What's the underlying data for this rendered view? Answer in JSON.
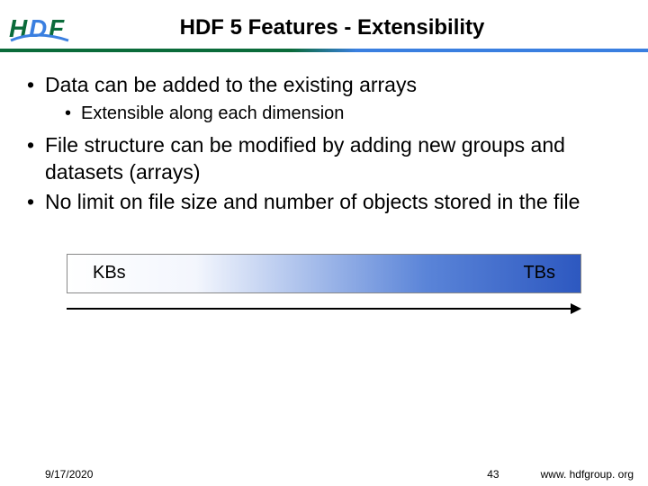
{
  "header": {
    "title": "HDF 5 Features - Extensibility",
    "logo_text": "HDF"
  },
  "bullets": {
    "b1": "Data can be added to the existing arrays",
    "b1_sub1": "Extensible along each dimension",
    "b2": "File structure can be modified by adding new groups and datasets (arrays)",
    "b3": "No limit on file size and number of objects stored in the file"
  },
  "scale": {
    "left": "KBs",
    "right": "TBs"
  },
  "footer": {
    "date": "9/17/2020",
    "page": "43",
    "url": "www. hdfgroup. org"
  }
}
